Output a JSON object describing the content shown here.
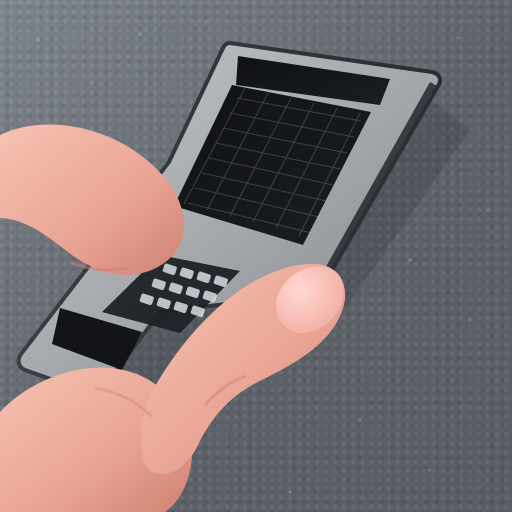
{
  "image": {
    "kind": "photo",
    "subjects": [
      "hand-with-finger",
      "handheld-device",
      "keyboard",
      "screen",
      "asphalt-ground"
    ]
  },
  "colors": {
    "asphalt_dark": "#5b6067",
    "asphalt_light": "#8b9097",
    "device_frame": "#a9abae",
    "device_frame_dark": "#3a3d42",
    "screen_black": "#121417",
    "keyboard_dark": "#1e2126",
    "key_light": "#d9dde2",
    "skin_light": "#f2b5a3",
    "skin_shadow": "#d88f7f",
    "nail": "#f7c9c0"
  }
}
